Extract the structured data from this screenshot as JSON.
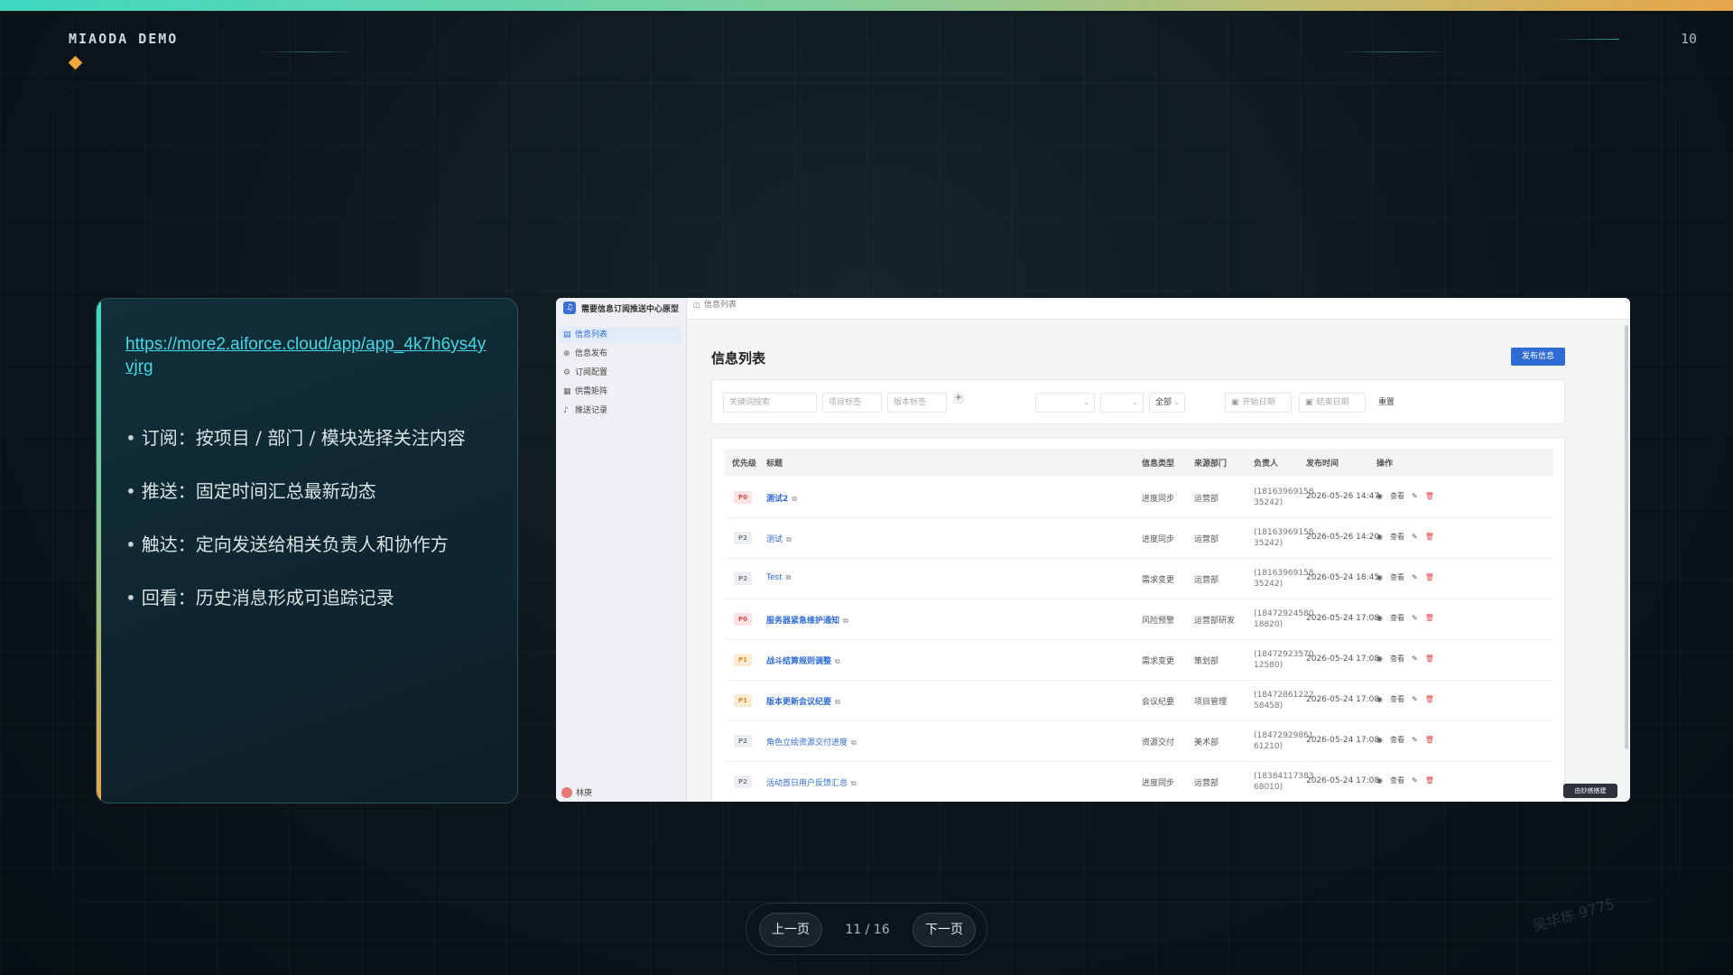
{
  "deck": {
    "brand": "MIAODA DEMO",
    "page_number": "10"
  },
  "card": {
    "link": "https://more2.aiforce.cloud/app/app_4k7h6ys4yvjrg",
    "bullets": [
      "订阅：按项目 / 部门 / 模块选择关注内容",
      "推送：固定时间汇总最新动态",
      "触达：定向发送给相关负责人和协作方",
      "回看：历史消息形成可追踪记录"
    ],
    "bullet_mark": "•"
  },
  "app": {
    "title": "需要信息订阅推送中心原型",
    "nav": [
      {
        "label": "信息列表",
        "icon": "document-icon",
        "active": true
      },
      {
        "label": "信息发布",
        "icon": "plus-circle-icon",
        "active": false
      },
      {
        "label": "订阅配置",
        "icon": "gear-icon",
        "active": false
      },
      {
        "label": "供需矩阵",
        "icon": "grid-icon",
        "active": false
      },
      {
        "label": "推送记录",
        "icon": "bell-icon",
        "active": false
      }
    ],
    "user_name": "林庚",
    "breadcrumb": "信息列表",
    "page_title": "信息列表",
    "publish_label": "发布信息",
    "filters": {
      "keyword_placeholder": "关键词搜索",
      "project_placeholder": "项目标签",
      "version_placeholder": "版本标签",
      "type_value": "",
      "dept_value": "",
      "priority_value": "全部",
      "start_placeholder": "开始日期",
      "end_placeholder": "结束日期",
      "reset_label": "重置"
    },
    "columns": [
      "优先级",
      "标题",
      "信息类型",
      "来源部门",
      "负责人",
      "发布时间",
      "操作"
    ],
    "rows": [
      {
        "priority": "P0",
        "title": "测试2",
        "bold": true,
        "type": "进度同步",
        "dept": "运营部",
        "owner1": "(18163969158",
        "owner2": "35242)",
        "time": "2026-05-26 14:47"
      },
      {
        "priority": "P2",
        "title": "测试",
        "bold": false,
        "type": "进度同步",
        "dept": "运营部",
        "owner1": "(18163969158",
        "owner2": "35242)",
        "time": "2026-05-26 14:20"
      },
      {
        "priority": "P2",
        "title": "Test",
        "bold": false,
        "type": "需求变更",
        "dept": "运营部",
        "owner1": "(18163969158",
        "owner2": "35242)",
        "time": "2026-05-24 18:45"
      },
      {
        "priority": "P0",
        "title": "服务器紧急维护通知",
        "bold": true,
        "type": "风险预警",
        "dept": "运营部研发",
        "owner1": "(18472924580",
        "owner2": "18820)",
        "time": "2026-05-24 17:08"
      },
      {
        "priority": "P1",
        "title": "战斗结算规则调整",
        "bold": true,
        "type": "需求变更",
        "dept": "策划部",
        "owner1": "(18472923570",
        "owner2": "12580)",
        "time": "2026-05-24 17:08"
      },
      {
        "priority": "P1",
        "title": "版本更新会议纪要",
        "bold": true,
        "type": "会议纪要",
        "dept": "项目管理",
        "owner1": "(18472861222",
        "owner2": "58458)",
        "time": "2026-05-24 17:08"
      },
      {
        "priority": "P2",
        "title": "角色立绘资源交付进度",
        "bold": false,
        "type": "资源交付",
        "dept": "美术部",
        "owner1": "(18472929861",
        "owner2": "61210)",
        "time": "2026-05-24 17:08"
      },
      {
        "priority": "P2",
        "title": "活动首日用户反馈汇总",
        "bold": false,
        "type": "进度同步",
        "dept": "运营部",
        "owner1": "(18384117383",
        "owner2": "68010)",
        "time": "2026-05-24 17:08"
      }
    ],
    "op_view": "查看",
    "float_label": "由妙搭搭建"
  },
  "pager": {
    "prev": "上一页",
    "count": "11 / 16",
    "next": "下一页"
  },
  "watermark": "吴华栋 9775",
  "colors": {
    "accent_teal": "#3fd9c2",
    "accent_orange": "#e7a64a",
    "link": "#44d8e6",
    "primary_blue": "#2f6bd3",
    "danger": "#e0454a"
  }
}
